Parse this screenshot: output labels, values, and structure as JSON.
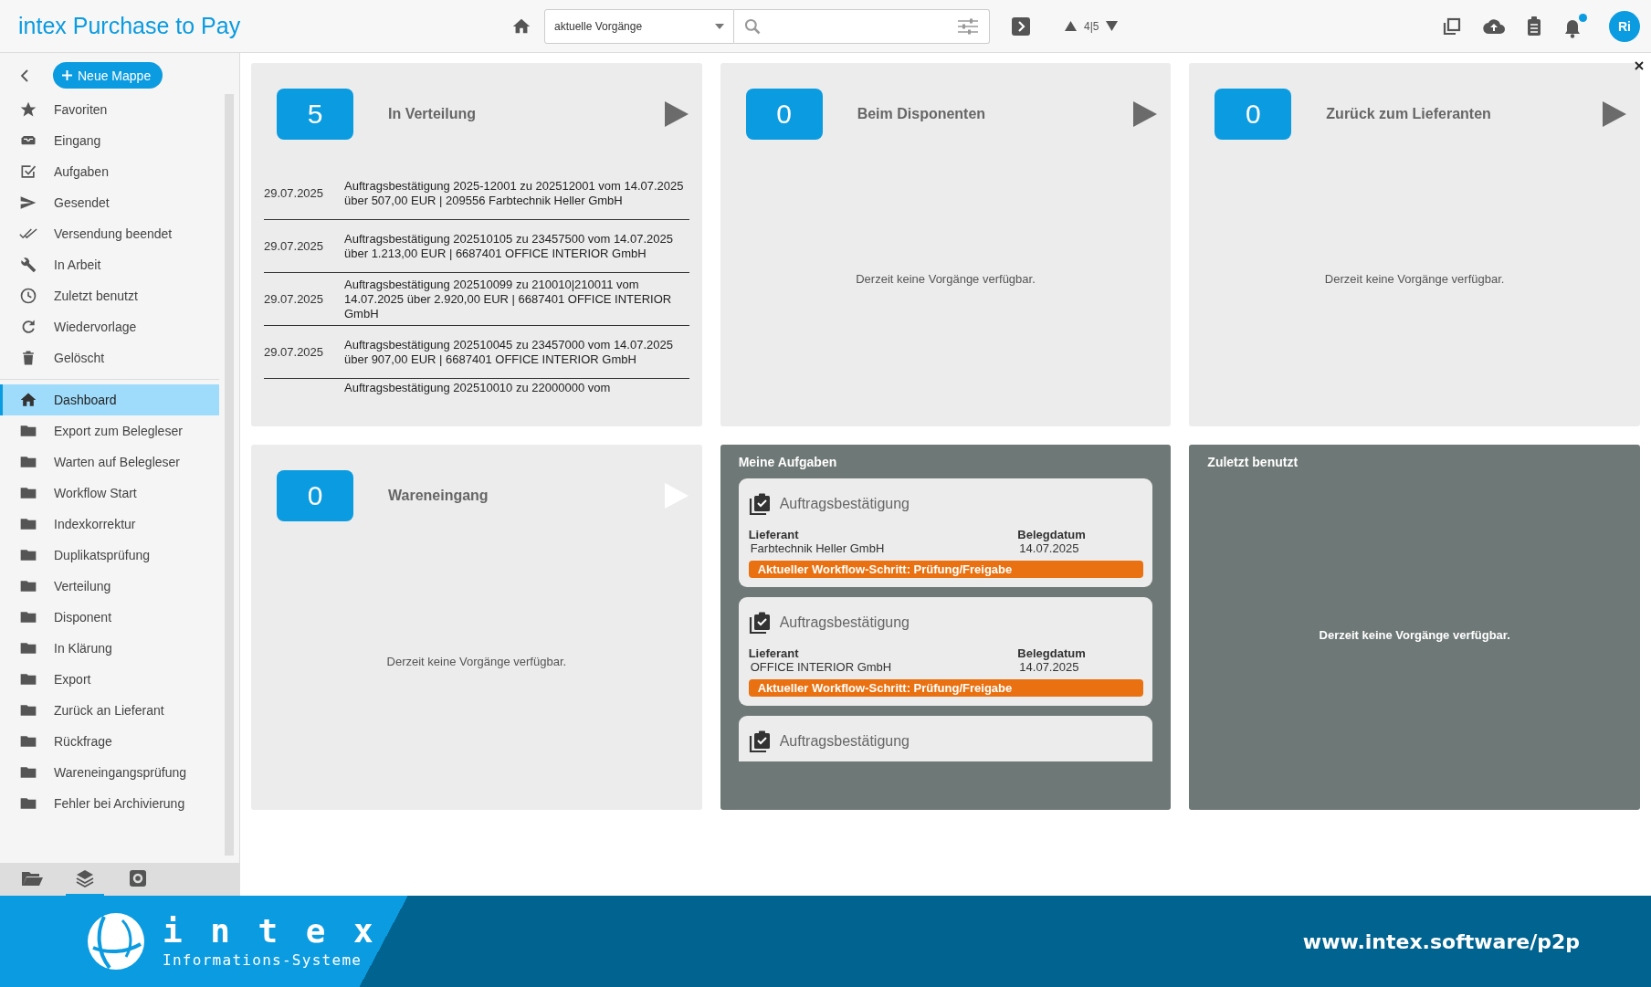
{
  "app_title": "intex Purchase to Pay",
  "toolbar": {
    "view_select": "aktuelle Vorgänge",
    "pager": "4|5",
    "avatar": "Ri",
    "notification_dot": true
  },
  "sidebar": {
    "new_button": "Neue Mappe",
    "system_items": [
      {
        "label": "Favoriten",
        "selected": false
      },
      {
        "label": "Eingang",
        "selected": false
      },
      {
        "label": "Aufgaben",
        "selected": false
      },
      {
        "label": "Gesendet",
        "selected": false
      },
      {
        "label": "Versendung beendet",
        "selected": false
      },
      {
        "label": "In Arbeit",
        "selected": false
      },
      {
        "label": "Zuletzt benutzt",
        "selected": false
      },
      {
        "label": "Wiedervorlage",
        "selected": false
      },
      {
        "label": "Gelöscht",
        "selected": false
      }
    ],
    "folders": [
      {
        "kind": "home",
        "label": "Dashboard",
        "selected": true
      },
      {
        "kind": "folder",
        "label": "Export zum Belegleser",
        "selected": false
      },
      {
        "kind": "folder",
        "label": "Warten auf Belegleser",
        "selected": false
      },
      {
        "kind": "folder",
        "label": "Workflow Start",
        "selected": false
      },
      {
        "kind": "folder",
        "label": "Indexkorrektur",
        "selected": false
      },
      {
        "kind": "folder",
        "label": "Duplikatsprüfung",
        "selected": false
      },
      {
        "kind": "folder",
        "label": "Verteilung",
        "selected": false
      },
      {
        "kind": "folder",
        "label": "Disponent",
        "selected": false
      },
      {
        "kind": "folder",
        "label": "In Klärung",
        "selected": false
      },
      {
        "kind": "folder",
        "label": "Export",
        "selected": false
      },
      {
        "kind": "folder",
        "label": "Zurück an Lieferant",
        "selected": false
      },
      {
        "kind": "folder",
        "label": "Rückfrage",
        "selected": false
      },
      {
        "kind": "folder",
        "label": "Wareneingangsprüfung",
        "selected": false
      },
      {
        "kind": "folder",
        "label": "Fehler bei Archivierung",
        "selected": false
      }
    ],
    "bottom_tabs": [
      {
        "kind": "folders",
        "selected": false
      },
      {
        "kind": "layers",
        "selected": true
      },
      {
        "kind": "settings",
        "selected": false
      }
    ]
  },
  "dashboard": [
    {
      "kind": "count",
      "count": "5",
      "title": "In Verteilung",
      "disabled": false,
      "rows": [
        {
          "date": "29.07.2025",
          "text": "Auftragsbestätigung 2025-12001 zu 202512001 vom 14.07.2025 über 507,00 EUR | 209556 Farbtechnik Heller GmbH"
        },
        {
          "date": "29.07.2025",
          "text": "Auftragsbestätigung 202510105 zu 23457500 vom 14.07.2025 über 1.213,00 EUR | 6687401 OFFICE INTERIOR GmbH"
        },
        {
          "date": "29.07.2025",
          "text": "Auftragsbestätigung 202510099 zu 210010|210011 vom 14.07.2025 über 2.920,00 EUR | 6687401 OFFICE INTERIOR GmbH"
        },
        {
          "date": "29.07.2025",
          "text": "Auftragsbestätigung 202510045 zu 23457000 vom 14.07.2025 über 907,00 EUR | 6687401 OFFICE INTERIOR GmbH"
        },
        {
          "text": "Auftragsbestätigung 202510010 zu 22000000 vom"
        }
      ]
    },
    {
      "kind": "count",
      "count": "0",
      "title": "Beim Disponenten",
      "disabled": false,
      "empty_text": "Derzeit keine Vorgänge verfügbar."
    },
    {
      "kind": "count",
      "count": "0",
      "title": "Zurück zum Lieferanten",
      "disabled": false,
      "empty_text": "Derzeit keine Vorgänge verfügbar."
    },
    {
      "kind": "count",
      "count": "0",
      "title": "Wareneingang",
      "disabled": true,
      "empty_text": "Derzeit keine Vorgänge verfügbar."
    },
    {
      "kind": "tasks",
      "title": "Meine Aufgaben",
      "tasks": [
        {
          "title": "Auftragsbestätigung",
          "supplier_label": "Lieferant",
          "supplier": "Farbtechnik Heller GmbH",
          "date_label": "Belegdatum",
          "date": "14.07.2025",
          "step": "Aktueller Workflow-Schritt: Prüfung/Freigabe"
        },
        {
          "title": "Auftragsbestätigung",
          "supplier_label": "Lieferant",
          "supplier": "OFFICE INTERIOR GmbH",
          "date_label": "Belegdatum",
          "date": "14.07.2025",
          "step": "Aktueller Workflow-Schritt: Prüfung/Freigabe"
        },
        {
          "title": "Auftragsbestätigung"
        }
      ]
    },
    {
      "kind": "recent",
      "title": "Zuletzt benutzt",
      "empty_text": "Derzeit keine Vorgänge verfügbar."
    }
  ],
  "footer": {
    "brand": "intex",
    "tagline": "Informations-Systeme",
    "url": "www.intex.software/p2p"
  }
}
